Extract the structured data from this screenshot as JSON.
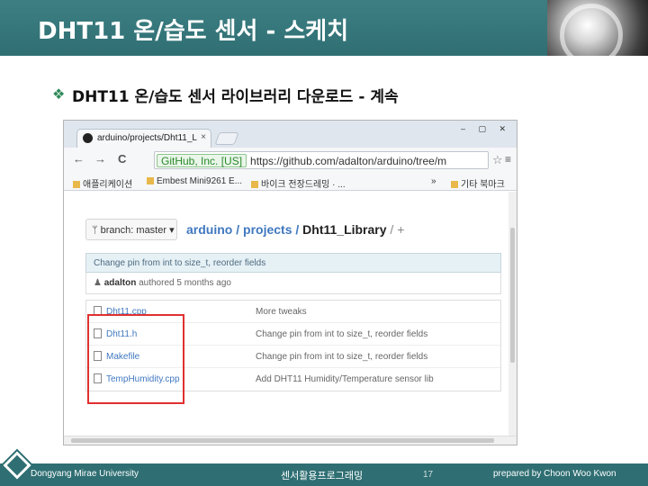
{
  "slide": {
    "title": "DHT11 온/습도 센서 - 스케치",
    "bullet_symbol": "❖",
    "bullet_text": "DHT11 온/습도 센서 라이브러리 다운로드 - 계속"
  },
  "browser": {
    "tab_title": "arduino/projects/Dht11_L",
    "tab_close": "×",
    "window_controls": "– ▢ ✕",
    "nav": {
      "back": "←",
      "forward": "→",
      "reload": "C"
    },
    "ev_badge": "GitHub, Inc. [US]",
    "url": "https://github.com/adalton/arduino/tree/m",
    "star": "☆",
    "menu": "≡",
    "bookmarks": [
      {
        "label": "애플리케이션"
      },
      {
        "label": "Embest Mini9261 E..."
      },
      {
        "label": "바이크 전장드레밍 · ..."
      }
    ],
    "bookmarks_more": "»",
    "bookmarks_other": "기타 북마크"
  },
  "github": {
    "branch_label": "branch: master",
    "breadcrumb": {
      "repo": "arduino",
      "sep1": " / ",
      "folder": "projects",
      "sep2": " / ",
      "current": "Dht11_Library",
      "tail": " / +"
    },
    "commit_message": "Change pin from int to size_t, reorder fields",
    "author": "adalton",
    "authored": "authored 5 months ago",
    "files": [
      {
        "name": "Dht11.cpp",
        "message": "More tweaks"
      },
      {
        "name": "Dht11.h",
        "message": "Change pin from int to size_t, reorder fields"
      },
      {
        "name": "Makefile",
        "message": "Change pin from int to size_t, reorder fields"
      },
      {
        "name": "TempHumidity.cpp",
        "message": "Add DHT11 Humidity/Temperature sensor lib"
      }
    ]
  },
  "footer": {
    "university": "Dongyang Mirae University",
    "course": "센서활용프로그래밍",
    "page": "17",
    "author": "prepared by Choon Woo Kwon"
  },
  "colors": {
    "theme": "#2f6f73",
    "highlight": "#e03030",
    "link": "#4078c0"
  }
}
